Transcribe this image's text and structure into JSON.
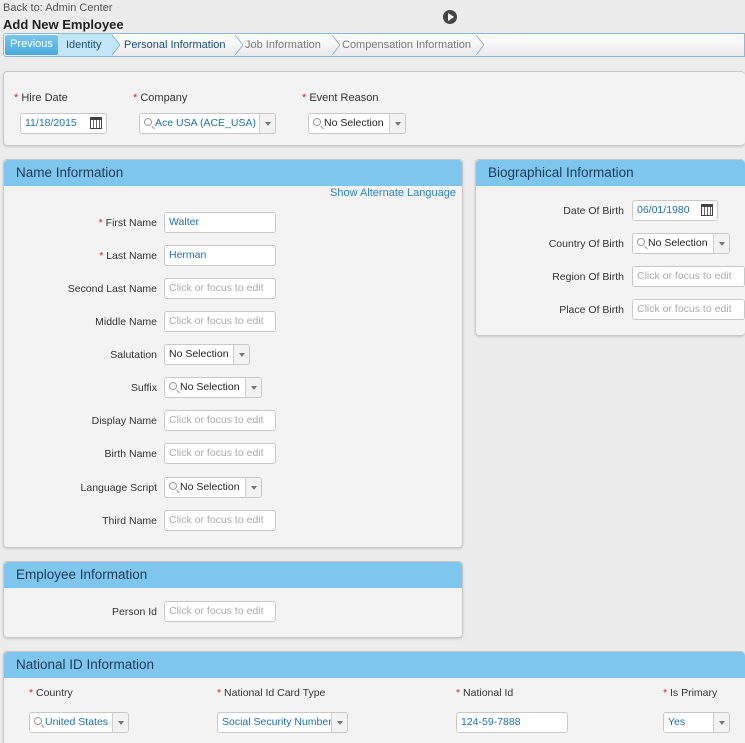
{
  "header": {
    "back_link": "Back to: Admin Center",
    "title": "Add New Employee"
  },
  "wizard": {
    "previous_label": "Previous",
    "steps": [
      {
        "label": "Identity",
        "state": "active"
      },
      {
        "label": "Personal Information",
        "state": "done"
      },
      {
        "label": "Job Information",
        "state": "todo"
      },
      {
        "label": "Compensation Information",
        "state": "todo"
      }
    ]
  },
  "hire": {
    "hire_date_label": "Hire Date",
    "hire_date_value": "11/18/2015",
    "company_label": "Company",
    "company_value": "Ace USA (ACE_USA)",
    "event_reason_label": "Event Reason",
    "event_reason_value": "No Selection"
  },
  "name_info": {
    "title": "Name Information",
    "alt_lang_link": "Show Alternate Language",
    "placeholder": "Click or focus to edit",
    "first_name_label": "First Name",
    "first_name_value": "Walter",
    "last_name_label": "Last Name",
    "last_name_value": "Herman",
    "second_last_name_label": "Second Last Name",
    "middle_name_label": "Middle Name",
    "salutation_label": "Salutation",
    "salutation_value": "No Selection",
    "suffix_label": "Suffix",
    "suffix_value": "No Selection",
    "display_name_label": "Display Name",
    "birth_name_label": "Birth Name",
    "language_script_label": "Language Script",
    "language_script_value": "No Selection",
    "third_name_label": "Third Name"
  },
  "bio_info": {
    "title": "Biographical Information",
    "dob_label": "Date Of Birth",
    "dob_value": "06/01/1980",
    "country_label": "Country Of Birth",
    "country_value": "No Selection",
    "region_label": "Region Of Birth",
    "place_label": "Place Of Birth",
    "placeholder": "Click or focus to edit"
  },
  "employee_info": {
    "title": "Employee Information",
    "person_id_label": "Person Id",
    "placeholder": "Click or focus to edit"
  },
  "national_id": {
    "title": "National ID Information",
    "country_label": "Country",
    "country_value": "United States",
    "card_type_label": "National Id Card Type",
    "card_type_value": "Social Security Number",
    "national_id_label": "National Id",
    "national_id_value": "124-59-7888",
    "is_primary_label": "Is Primary",
    "is_primary_value": "Yes"
  },
  "required_mark": "*"
}
